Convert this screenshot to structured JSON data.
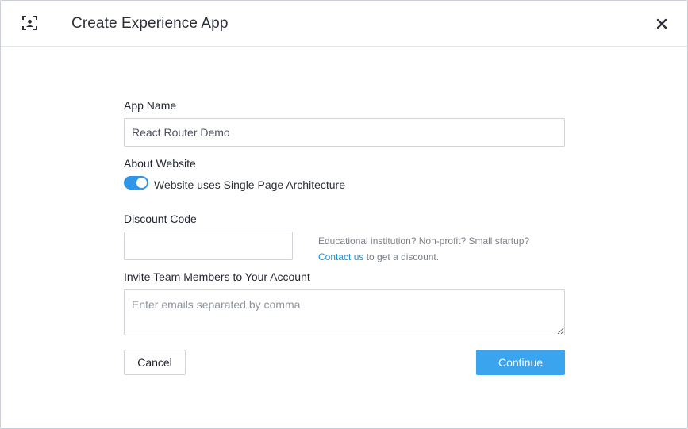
{
  "dialog": {
    "title": "Create Experience App",
    "close_icon": "close-icon",
    "app_icon": "app-frame-icon"
  },
  "form": {
    "app_name": {
      "label": "App Name",
      "value": "React Router Demo",
      "placeholder": ""
    },
    "about_website": {
      "label": "About Website",
      "toggle_label": "Website uses Single Page Architecture",
      "toggle_on": true
    },
    "discount_code": {
      "label": "Discount Code",
      "value": "",
      "hint_text": "Educational institution? Non-profit? Small startup?",
      "hint_link": "Contact us",
      "hint_suffix": " to get a discount."
    },
    "invite": {
      "label": "Invite Team Members to Your Account",
      "placeholder": "Enter emails separated by comma",
      "value": ""
    }
  },
  "actions": {
    "cancel_label": "Cancel",
    "continue_label": "Continue"
  },
  "colors": {
    "accent": "#3aa4ee",
    "toggle": "#2f95e6",
    "link": "#1e8fd8"
  }
}
